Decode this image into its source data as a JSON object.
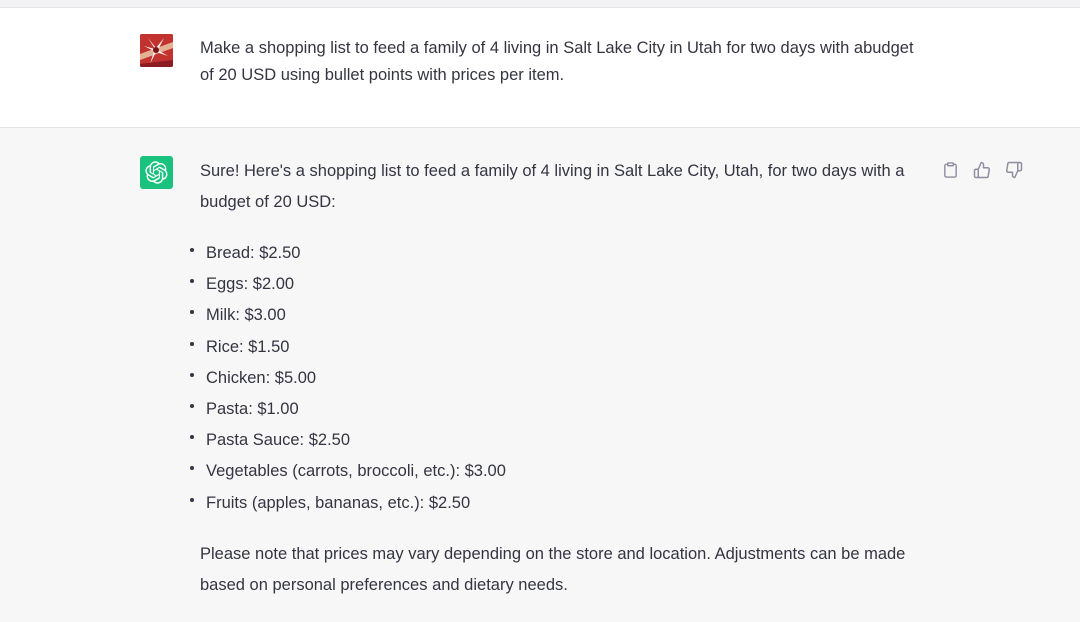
{
  "conversation": {
    "user_message": {
      "text": "Make a shopping list to feed a family of 4 living in Salt Lake City in Utah for two days with abudget of 20 USD using bullet points with prices per item."
    },
    "assistant_message": {
      "intro": "Sure! Here's a shopping list to feed a family of 4 living in Salt Lake City, Utah, for two days with a budget of 20 USD:",
      "items": [
        "Bread: $2.50",
        "Eggs: $2.00",
        "Milk: $3.00",
        "Rice: $1.50",
        "Chicken: $5.00",
        "Pasta: $1.00",
        "Pasta Sauce: $2.50",
        "Vegetables (carrots, broccoli, etc.): $3.00",
        "Fruits (apples, bananas, etc.): $2.50"
      ],
      "note": "Please note that prices may vary depending on the store and location. Adjustments can be made based on personal preferences and dietary needs."
    },
    "actions": [
      "clipboard-icon",
      "thumbs-up-icon",
      "thumbs-down-icon"
    ]
  },
  "colors": {
    "assistant_bg": "#f7f7f8",
    "user_bg": "#ffffff",
    "bot_avatar": "#19c37d",
    "text": "#343541",
    "icon": "#8e8ea0"
  }
}
